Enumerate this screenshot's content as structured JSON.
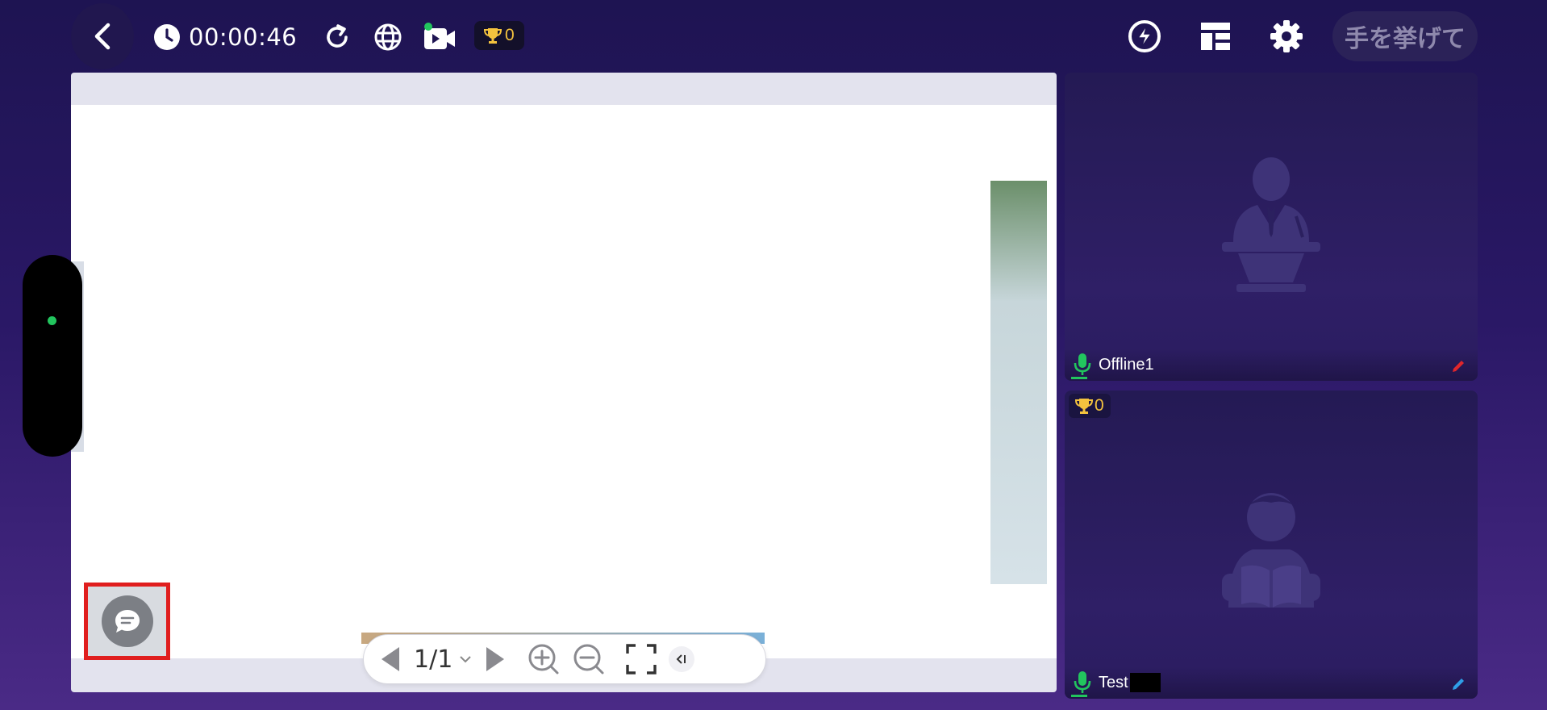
{
  "header": {
    "timer": "00:00:46",
    "trophy_count": "0",
    "raise_hand_label": "手を挙げて"
  },
  "whiteboard": {
    "page_indicator": "1/1"
  },
  "participants": [
    {
      "name": "Offline1",
      "pencil_color": "#e0262b"
    },
    {
      "name": "Test",
      "trophy_count": "0",
      "pencil_color": "#2f9fe8"
    }
  ],
  "colors": {
    "mic_green": "#22c55e",
    "trophy_gold": "#f4c33e",
    "highlight_red": "#e01e1e"
  }
}
